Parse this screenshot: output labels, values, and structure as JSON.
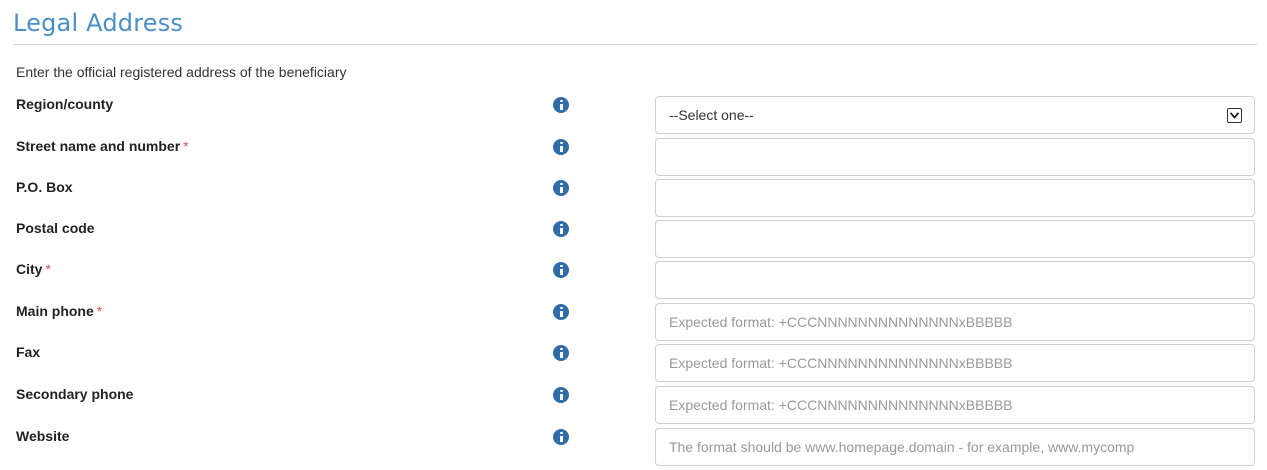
{
  "section": {
    "title": "Legal Address",
    "description": "Enter the official registered address of the beneficiary"
  },
  "required_marker": "*",
  "fields": [
    {
      "label": "Region/county",
      "required": false,
      "type": "select",
      "value": "--Select one--"
    },
    {
      "label": "Street name and number",
      "required": true,
      "type": "text",
      "placeholder": ""
    },
    {
      "label": "P.O. Box",
      "required": false,
      "type": "text",
      "placeholder": ""
    },
    {
      "label": "Postal code",
      "required": false,
      "type": "text",
      "placeholder": ""
    },
    {
      "label": "City",
      "required": true,
      "type": "text",
      "placeholder": ""
    },
    {
      "label": "Main phone",
      "required": true,
      "type": "text",
      "placeholder": "Expected format: +CCCNNNNNNNNNNNNNNxBBBBB"
    },
    {
      "label": "Fax",
      "required": false,
      "type": "text",
      "placeholder": "Expected format: +CCCNNNNNNNNNNNNNNxBBBBB"
    },
    {
      "label": "Secondary phone",
      "required": false,
      "type": "text",
      "placeholder": "Expected format: +CCCNNNNNNNNNNNNNNxBBBBB"
    },
    {
      "label": "Website",
      "required": false,
      "type": "text",
      "placeholder": "The format should be www.homepage.domain - for example, www.mycomp"
    }
  ],
  "colors": {
    "title": "#4a8fc7",
    "info_icon": "#2f6da8",
    "required": "#d9534f",
    "border": "#cfcfcf"
  },
  "icons": {
    "info": "info-circle-icon",
    "dropdown": "chevron-down-icon"
  }
}
